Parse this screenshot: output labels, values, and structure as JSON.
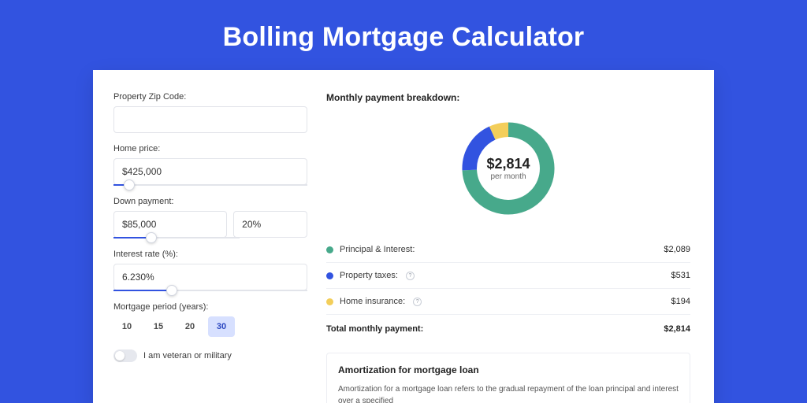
{
  "page": {
    "title": "Bolling Mortgage Calculator"
  },
  "form": {
    "zip_label": "Property Zip Code:",
    "zip_value": "",
    "home_price_label": "Home price:",
    "home_price_value": "$425,000",
    "home_price_slider_pct": 8,
    "down_payment_label": "Down payment:",
    "down_payment_value": "$85,000",
    "down_payment_pct_value": "20%",
    "down_payment_slider_pct": 20,
    "interest_label": "Interest rate (%):",
    "interest_value": "6.230%",
    "interest_slider_pct": 30,
    "period_label": "Mortgage period (years):",
    "periods": {
      "p10": "10",
      "p15": "15",
      "p20": "20",
      "p30": "30",
      "active": "30"
    },
    "veteran_label": "I am veteran or military"
  },
  "breakdown": {
    "title": "Monthly payment breakdown:",
    "donut_center_amount": "$2,814",
    "donut_center_sub": "per month",
    "items": {
      "principal": {
        "label": "Principal & Interest:",
        "value": "$2,089"
      },
      "taxes": {
        "label": "Property taxes:",
        "value": "$531"
      },
      "insurance": {
        "label": "Home insurance:",
        "value": "$194"
      }
    },
    "total_label": "Total monthly payment:",
    "total_value": "$2,814"
  },
  "amortization": {
    "title": "Amortization for mortgage loan",
    "text": "Amortization for a mortgage loan refers to the gradual repayment of the loan principal and interest over a specified"
  },
  "chart_data": {
    "type": "pie",
    "title": "Monthly payment breakdown",
    "series": [
      {
        "name": "Principal & Interest",
        "value": 2089,
        "color": "#47a98b"
      },
      {
        "name": "Property taxes",
        "value": 531,
        "color": "#3253e0"
      },
      {
        "name": "Home insurance",
        "value": 194,
        "color": "#f3ce5a"
      }
    ],
    "total": 2814
  }
}
